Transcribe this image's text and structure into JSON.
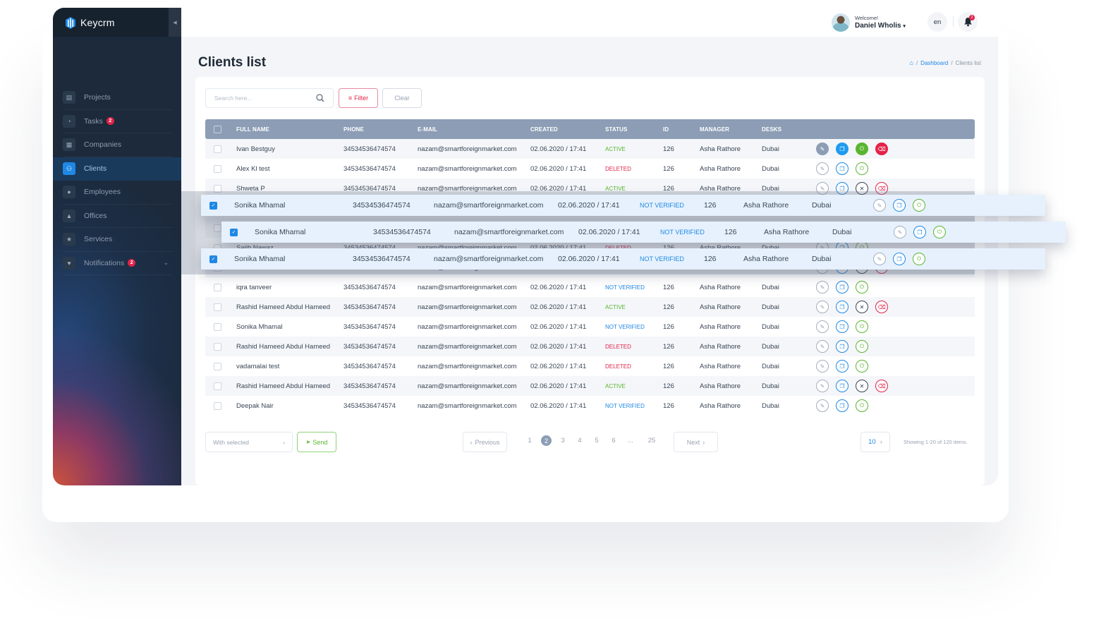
{
  "app": {
    "logo": "Keycrm",
    "collapse_icon": "chevron-left"
  },
  "sidebar": {
    "items": [
      {
        "label": "Projects",
        "icon": "briefcase-icon",
        "badge": null,
        "active": false
      },
      {
        "label": "Tasks",
        "icon": "stopwatch-icon",
        "badge": "2",
        "active": false
      },
      {
        "label": "Companies",
        "icon": "building-icon",
        "badge": null,
        "active": false
      },
      {
        "label": "Clients",
        "icon": "users-icon",
        "badge": null,
        "active": true
      },
      {
        "label": "Employees",
        "icon": "user-icon",
        "badge": null,
        "active": false
      },
      {
        "label": "Offices",
        "icon": "bank-icon",
        "badge": null,
        "active": false
      },
      {
        "label": "Services",
        "icon": "star-icon",
        "badge": null,
        "active": false
      },
      {
        "label": "Notifications",
        "icon": "bell-icon",
        "badge": "2",
        "active": false,
        "expandable": true
      }
    ]
  },
  "header": {
    "welcome": "Welcome!",
    "user_name": "Daniel Wholis",
    "language": "en",
    "notification_count": "2"
  },
  "page": {
    "title": "Clients list",
    "breadcrumb": {
      "home_icon": "home-icon",
      "link": "Dashboard",
      "current": "Clients list",
      "sep": "/"
    }
  },
  "toolbar": {
    "search_placeholder": "Search here...",
    "filter_label": "Filter",
    "clear_label": "Clear"
  },
  "table": {
    "columns": [
      "FULL NAME",
      "PHONE",
      "E-MAIL",
      "CREATED",
      "STATUS",
      "ID",
      "MANAGER",
      "DESKS"
    ],
    "rows": [
      {
        "name": "Ivan Bestguy",
        "phone": "34534536474574",
        "email": "nazam@smartforeignmarket.com",
        "created": "02.06.2020 / 17:41",
        "status": "ACTIVE",
        "id": "126",
        "manager": "Asha Rathore",
        "desk": "Dubai",
        "actions": [
          "edit",
          "copy",
          "power",
          "delete"
        ],
        "filled": true
      },
      {
        "name": "Alex Kl test",
        "phone": "34534536474574",
        "email": "nazam@smartforeignmarket.com",
        "created": "02.06.2020 / 17:41",
        "status": "DELETED",
        "id": "126",
        "manager": "Asha Rathore",
        "desk": "Dubai",
        "actions": [
          "edit",
          "copy",
          "power"
        ]
      },
      {
        "name": "Shweta P",
        "phone": "34534536474574",
        "email": "nazam@smartforeignmarket.com",
        "created": "02.06.2020 / 17:41",
        "status": "ACTIVE",
        "id": "126",
        "manager": "Asha Rathore",
        "desk": "Dubai",
        "actions": [
          "edit",
          "copy",
          "close",
          "delete"
        ]
      },
      {
        "name": "Sonika Mhamal",
        "phone": "34534536474574",
        "email": "nazam@smartforeignmarket.com",
        "created": "02.06.2020 / 17:41",
        "status": "NOT VERIFIED",
        "id": "126",
        "manager": "Asha Rathore",
        "desk": "Dubai",
        "actions": [
          "edit",
          "copy",
          "power"
        ]
      },
      {
        "name": "Sonika Mhamal",
        "phone": "34534536474574",
        "email": "nazam@smartforeignmarket.com",
        "created": "02.06.2020 / 17:41",
        "status": "NOT VERIFIED",
        "id": "126",
        "manager": "Asha Rathore",
        "desk": "Dubai",
        "actions": [
          "edit",
          "copy",
          "power"
        ]
      },
      {
        "name": "Sajib Nawaz",
        "phone": "34534536474574",
        "email": "nazam@smartforeignmarket.com",
        "created": "02.06.2020 / 17:41",
        "status": "DELETED",
        "id": "126",
        "manager": "Asha Rathore",
        "desk": "Dubai",
        "actions": [
          "edit",
          "copy",
          "power"
        ]
      },
      {
        "name": "Sonika Mhamal",
        "phone": "34534536474574",
        "email": "nazam@smartforeignmarket.com",
        "created": "02.06.2020 / 17:41",
        "status": "NOT VERIFIED",
        "id": "126",
        "manager": "Asha Rathore",
        "desk": "Dubai",
        "actions": [
          "edit",
          "copy",
          "close",
          "delete"
        ]
      },
      {
        "name": "iqra tanveer",
        "phone": "34534536474574",
        "email": "nazam@smartforeignmarket.com",
        "created": "02.06.2020 / 17:41",
        "status": "NOT VERIFIED",
        "id": "126",
        "manager": "Asha Rathore",
        "desk": "Dubai",
        "actions": [
          "edit",
          "copy",
          "power"
        ]
      },
      {
        "name": "Rashid Hameed Abdul Hameed",
        "phone": "34534536474574",
        "email": "nazam@smartforeignmarket.com",
        "created": "02.06.2020 / 17:41",
        "status": "ACTIVE",
        "id": "126",
        "manager": "Asha Rathore",
        "desk": "Dubai",
        "actions": [
          "edit",
          "copy",
          "close",
          "delete"
        ]
      },
      {
        "name": "Sonika Mhamal",
        "phone": "34534536474574",
        "email": "nazam@smartforeignmarket.com",
        "created": "02.06.2020 / 17:41",
        "status": "NOT VERIFIED",
        "id": "126",
        "manager": "Asha Rathore",
        "desk": "Dubai",
        "actions": [
          "edit",
          "copy",
          "power"
        ]
      },
      {
        "name": "Rashid Hameed Abdul Hameed",
        "phone": "34534536474574",
        "email": "nazam@smartforeignmarket.com",
        "created": "02.06.2020 / 17:41",
        "status": "DELETED",
        "id": "126",
        "manager": "Asha Rathore",
        "desk": "Dubai",
        "actions": [
          "edit",
          "copy",
          "power"
        ]
      },
      {
        "name": "vadamalai test",
        "phone": "34534536474574",
        "email": "nazam@smartforeignmarket.com",
        "created": "02.06.2020 / 17:41",
        "status": "DELETED",
        "id": "126",
        "manager": "Asha Rathore",
        "desk": "Dubai",
        "actions": [
          "edit",
          "copy",
          "power"
        ]
      },
      {
        "name": "Rashid Hameed Abdul Hameed",
        "phone": "34534536474574",
        "email": "nazam@smartforeignmarket.com",
        "created": "02.06.2020 / 17:41",
        "status": "ACTIVE",
        "id": "126",
        "manager": "Asha Rathore",
        "desk": "Dubai",
        "actions": [
          "edit",
          "copy",
          "close",
          "delete"
        ]
      },
      {
        "name": "Deepak Nair",
        "phone": "34534536474574",
        "email": "nazam@smartforeignmarket.com",
        "created": "02.06.2020 / 17:41",
        "status": "NOT VERIFIED",
        "id": "126",
        "manager": "Asha Rathore",
        "desk": "Dubai",
        "actions": [
          "edit",
          "copy",
          "power"
        ]
      }
    ],
    "floating_rows": [
      {
        "name": "Sonika Mhamal",
        "phone": "34534536474574",
        "email": "nazam@smartforeignmarket.com",
        "created": "02.06.2020 / 17:41",
        "status": "NOT VERIFIED",
        "id": "126",
        "manager": "Asha Rathore",
        "desk": "Dubai",
        "checked": true
      },
      {
        "name": "Sonika Mhamal",
        "phone": "34534536474574",
        "email": "nazam@smartforeignmarket.com",
        "created": "02.06.2020 / 17:41",
        "status": "NOT VERIFIED",
        "id": "126",
        "manager": "Asha Rathore",
        "desk": "Dubai",
        "checked": true
      },
      {
        "name": "Sonika Mhamal",
        "phone": "34534536474574",
        "email": "nazam@smartforeignmarket.com",
        "created": "02.06.2020 / 17:41",
        "status": "NOT VERIFIED",
        "id": "126",
        "manager": "Asha Rathore",
        "desk": "Dubai",
        "checked": true
      }
    ]
  },
  "footer": {
    "bulk_action": "With selected",
    "send_label": "Send",
    "prev_label": "Previous",
    "next_label": "Next",
    "pages": [
      "1",
      "2",
      "3",
      "4",
      "5",
      "6",
      "...",
      "25"
    ],
    "current_page": "2",
    "per_page": "10",
    "showing": "Showing 1-20 of 120 items."
  },
  "colors": {
    "accent": "#1e88e5",
    "active": "#59b530",
    "deleted": "#e3234a",
    "header": "#8c9db5",
    "sidebar": "#1c2a3c"
  }
}
